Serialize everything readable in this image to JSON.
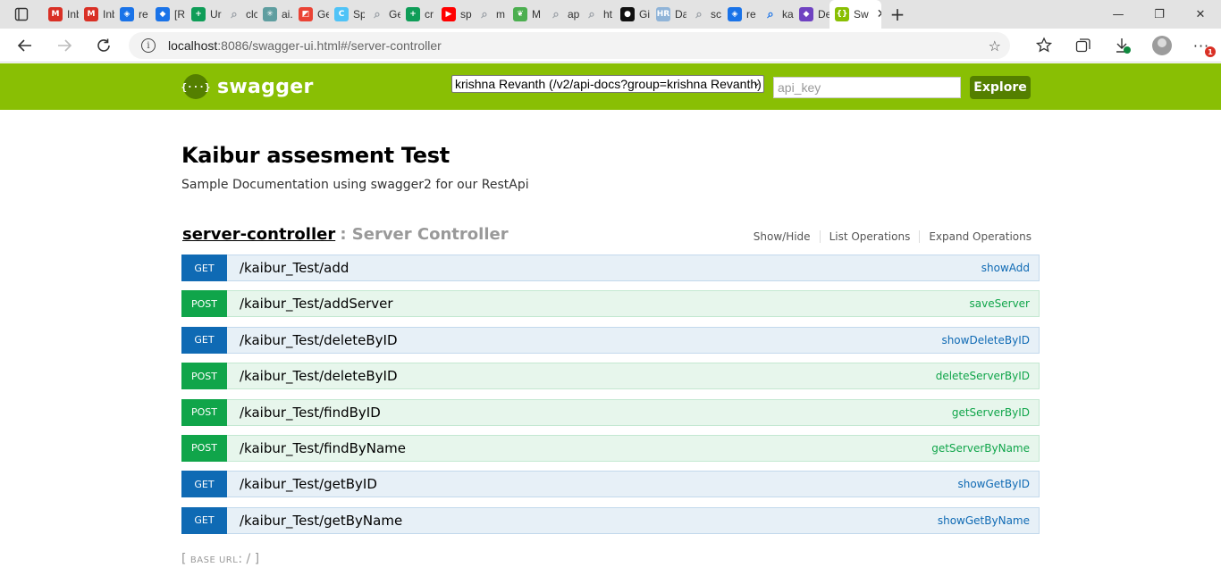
{
  "browser": {
    "tabs": [
      {
        "icon": "gmail-icon",
        "title": "Inb",
        "color": "#d93025"
      },
      {
        "icon": "gmail-icon",
        "title": "Inb",
        "color": "#d93025"
      },
      {
        "icon": "shield-icon",
        "title": "re",
        "color": "#1a73e8"
      },
      {
        "icon": "diamond-icon",
        "title": "[R",
        "color": "#1a73e8"
      },
      {
        "icon": "plus-doc-icon",
        "title": "Ur",
        "color": "#0f9d58"
      },
      {
        "icon": "search-icon",
        "title": "clc",
        "color": "#9aa0a6"
      },
      {
        "icon": "snowflake-icon",
        "title": "ai.",
        "color": "#5f9ea0"
      },
      {
        "icon": "chart-doc-icon",
        "title": "Ge",
        "color": "#ea4335"
      },
      {
        "icon": "c-icon",
        "title": "Sp",
        "color": "#4fc3f7"
      },
      {
        "icon": "search-icon",
        "title": "Ge",
        "color": "#9aa0a6"
      },
      {
        "icon": "plus-doc-icon",
        "title": "cr",
        "color": "#0f9d58"
      },
      {
        "icon": "youtube-icon",
        "title": "sp",
        "color": "#ff0000"
      },
      {
        "icon": "search-icon",
        "title": "m",
        "color": "#9aa0a6"
      },
      {
        "icon": "leaf-icon",
        "title": "M",
        "color": "#4caf50"
      },
      {
        "icon": "search-icon",
        "title": "ap",
        "color": "#9aa0a6"
      },
      {
        "icon": "search-icon",
        "title": "ht",
        "color": "#9aa0a6"
      },
      {
        "icon": "github-icon",
        "title": "Gi",
        "color": "#111111"
      },
      {
        "icon": "hr-icon",
        "title": "Da",
        "color": "#90b4d8"
      },
      {
        "icon": "search-icon",
        "title": "sc",
        "color": "#9aa0a6"
      },
      {
        "icon": "shield-icon",
        "title": "re",
        "color": "#1a73e8"
      },
      {
        "icon": "search-icon",
        "title": "ka",
        "color": "#1a73e8"
      },
      {
        "icon": "heroku-icon",
        "title": "De",
        "color": "#6f42c1"
      }
    ],
    "active_tab": {
      "title": "Sw",
      "close": "✕"
    },
    "new_tab": "+",
    "window": {
      "minimize": "—",
      "restore": "❐",
      "close": "✕"
    },
    "url_host": "localhost",
    "url_rest": ":8086/swagger-ui.html#/server-controller",
    "info_icon": "i",
    "star_icon": "☆",
    "downloads_badge": "1"
  },
  "swagger": {
    "brand_color": "#89bf04",
    "logo_mark": "{···}",
    "logo_text": "swagger",
    "group_select": "krishna Revanth (/v2/api-docs?group=krishna Revanth)",
    "api_key_placeholder": "api_key",
    "explore_label": "Explore"
  },
  "api": {
    "title": "Kaibur assesment Test",
    "description": "Sample Documentation using swagger2 for our RestApi"
  },
  "controller": {
    "name": "server-controller",
    "separator_description": ": Server Controller",
    "links": [
      "Show/Hide",
      "List Operations",
      "Expand Operations"
    ]
  },
  "operations": [
    {
      "method": "GET",
      "path": "/kaibur_Test/add",
      "nickname": "showAdd"
    },
    {
      "method": "POST",
      "path": "/kaibur_Test/addServer",
      "nickname": "saveServer"
    },
    {
      "method": "GET",
      "path": "/kaibur_Test/deleteByID",
      "nickname": "showDeleteByID"
    },
    {
      "method": "POST",
      "path": "/kaibur_Test/deleteByID",
      "nickname": "deleteServerByID"
    },
    {
      "method": "POST",
      "path": "/kaibur_Test/findByID",
      "nickname": "getServerByID"
    },
    {
      "method": "POST",
      "path": "/kaibur_Test/findByName",
      "nickname": "getServerByName"
    },
    {
      "method": "GET",
      "path": "/kaibur_Test/getByID",
      "nickname": "showGetByID"
    },
    {
      "method": "GET",
      "path": "/kaibur_Test/getByName",
      "nickname": "showGetByName"
    }
  ],
  "footer": {
    "open": "[",
    "label": "base url",
    "value": ": /",
    "close": "]"
  }
}
